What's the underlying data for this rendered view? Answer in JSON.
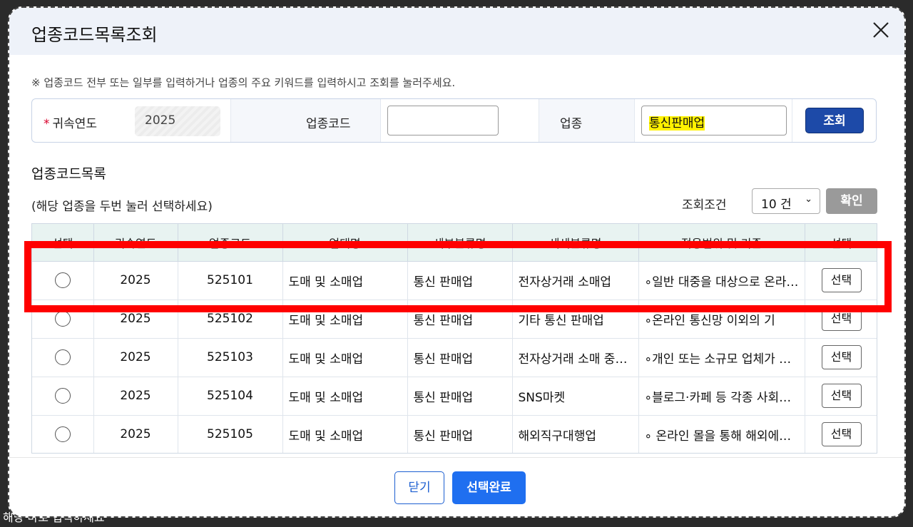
{
  "background_text": "해당 마로 입력하세요",
  "modal": {
    "title": "업종코드목록조회",
    "notice": "※ 업종코드 전부 또는 일부를 입력하거나 업종의 주요 키워드를 입력하시고 조회를 눌러주세요.",
    "search": {
      "required_mark": "*",
      "year_label": "귀속연도",
      "year_value": "2025",
      "code_label": "업종코드",
      "code_value": "",
      "industry_label": "업종",
      "industry_value": "통신판매업",
      "search_button": "조회"
    },
    "list": {
      "title": "업종코드목록",
      "hint": "(해당 업종을 두번 눌러 선택하세요)",
      "condition_label": "조회조건",
      "condition_value": "10 건",
      "confirm_button": "확인",
      "columns": [
        "선택",
        "귀속연도",
        "업종코드",
        "업태명",
        "세부분류명",
        "세세분류명",
        "적용범위 및 기준",
        "선택"
      ],
      "rows": [
        {
          "year": "2025",
          "code": "525101",
          "biz": "도매 및 소매업",
          "sub": "통신 판매업",
          "subsub": "전자상거래 소매업",
          "scope": "∘일반 대중을 대상으로 온라인 쇼핑몰",
          "btn": "선택"
        },
        {
          "year": "2025",
          "code": "525102",
          "biz": "도매 및 소매업",
          "sub": "통신 판매업",
          "subsub": "기타 통신 판매업",
          "scope": "∘온라인 통신망 이외의 기",
          "btn": "선택"
        },
        {
          "year": "2025",
          "code": "525103",
          "biz": "도매 및 소매업",
          "sub": "통신 판매업",
          "subsub": "전자상거래 소매 중개업",
          "scope": "∘개인 또는 소규모 업체가 운영",
          "btn": "선택"
        },
        {
          "year": "2025",
          "code": "525104",
          "biz": "도매 및 소매업",
          "sub": "통신 판매업",
          "subsub": "SNS마켓",
          "scope": "∘블로그·카페 등 각종 사회관계망",
          "btn": "선택"
        },
        {
          "year": "2025",
          "code": "525105",
          "biz": "도매 및 소매업",
          "sub": "통신 판매업",
          "subsub": "해외직구대행업",
          "scope": "∘ 온라인 몰을 통해 해외에서 구매",
          "btn": "선택"
        }
      ]
    },
    "footer": {
      "close_button": "닫기",
      "done_button": "선택완료"
    }
  },
  "colors": {
    "header_bg": "#eef2f9",
    "primary": "#1f6ff0",
    "search_btn": "#1d4aa8",
    "highlight": "#fff200",
    "annotation_box": "#ff0000",
    "table_header_bg": "#e8f3f1"
  }
}
